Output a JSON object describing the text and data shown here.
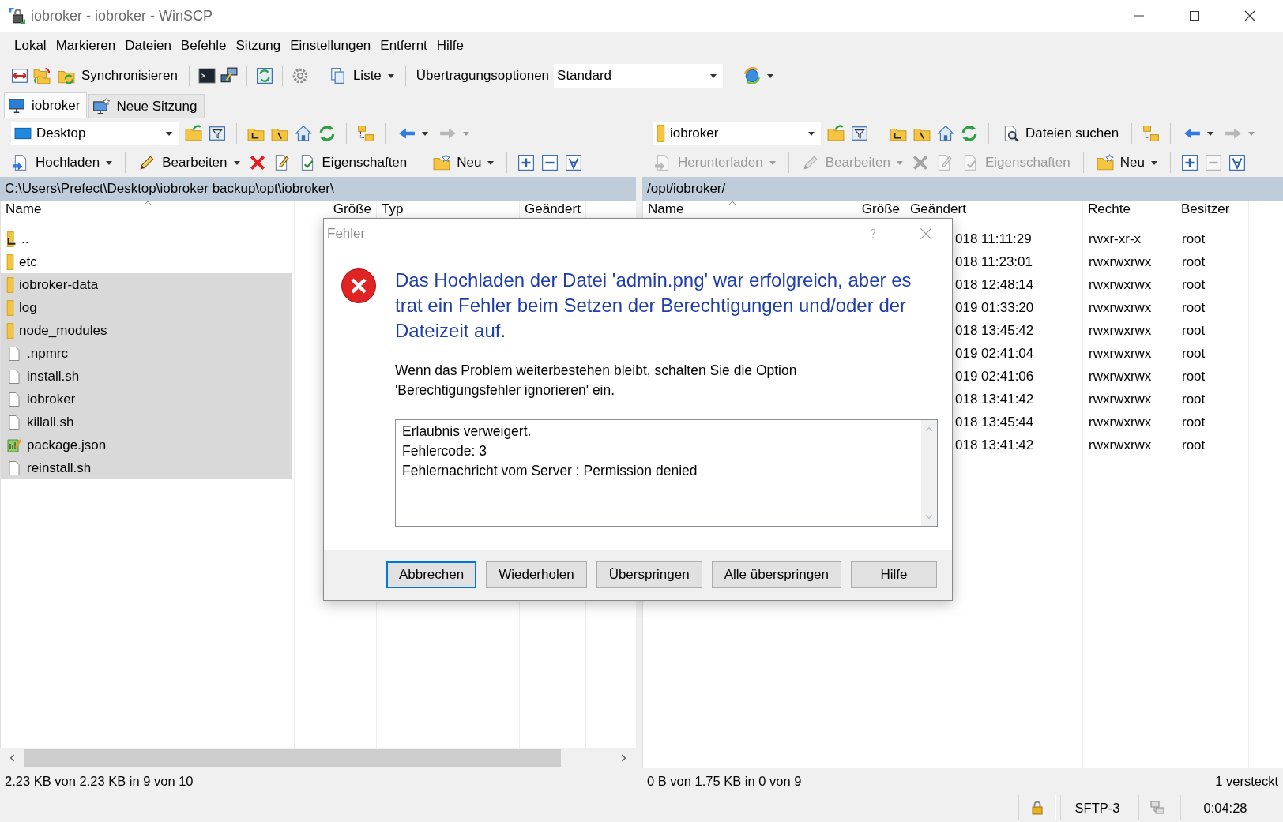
{
  "window": {
    "title": "iobroker - iobroker - WinSCP"
  },
  "menu": [
    "Lokal",
    "Markieren",
    "Dateien",
    "Befehle",
    "Sitzung",
    "Einstellungen",
    "Entfernt",
    "Hilfe"
  ],
  "toolbar": {
    "sync_label": "Synchronisieren",
    "view_label": "Liste",
    "transfer_label": "Übertragungsoptionen",
    "transfer_value": "Standard"
  },
  "session_tabs": [
    {
      "label": "iobroker",
      "selected": true
    },
    {
      "label": "Neue Sitzung",
      "selected": false
    }
  ],
  "left_panel": {
    "location": "Desktop",
    "history": {
      "back_disabled": false,
      "forward_disabled": true
    },
    "actions": [
      {
        "kind": "upload",
        "label": "Hochladen",
        "disabled": false
      },
      {
        "kind": "edit",
        "label": "Bearbeiten",
        "disabled": false
      },
      {
        "kind": "delete",
        "disabled": false
      },
      {
        "kind": "rename",
        "disabled": false
      },
      {
        "kind": "properties",
        "label": "Eigenschaften",
        "disabled": false
      },
      {
        "kind": "new",
        "label": "Neu",
        "disabled": false
      },
      {
        "kind": "select",
        "disabled": false
      },
      {
        "kind": "unselect",
        "disabled": false
      },
      {
        "kind": "filter_select",
        "disabled": false
      }
    ],
    "path": "C:\\Users\\Prefect\\Desktop\\iobroker backup\\opt\\iobroker\\",
    "columns": [
      "Name",
      "Größe",
      "Typ",
      "Geändert"
    ],
    "rows": [
      {
        "kind": "parent",
        "name": "..",
        "selected": false
      },
      {
        "kind": "folder",
        "name": "etc",
        "selected": false
      },
      {
        "kind": "folder",
        "name": "iobroker-data",
        "selected": true
      },
      {
        "kind": "folder",
        "name": "log",
        "selected": true
      },
      {
        "kind": "folder",
        "name": "node_modules",
        "selected": true
      },
      {
        "kind": "file",
        "name": ".npmrc",
        "selected": true
      },
      {
        "kind": "file",
        "name": "install.sh",
        "selected": true
      },
      {
        "kind": "file",
        "name": "iobroker",
        "selected": true
      },
      {
        "kind": "file",
        "name": "killall.sh",
        "selected": true
      },
      {
        "kind": "json",
        "name": "package.json",
        "selected": true
      },
      {
        "kind": "file",
        "name": "reinstall.sh",
        "selected": true
      }
    ],
    "status": "2.23 KB von 2.23 KB in 9 von 10"
  },
  "right_panel": {
    "location": "iobroker",
    "search_label": "Dateien suchen",
    "history": {
      "back_disabled": false,
      "forward_disabled": true
    },
    "actions": [
      {
        "kind": "download",
        "label": "Herunterladen",
        "disabled": true
      },
      {
        "kind": "edit",
        "label": "Bearbeiten",
        "disabled": true
      },
      {
        "kind": "delete",
        "disabled": true
      },
      {
        "kind": "rename",
        "disabled": true
      },
      {
        "kind": "properties",
        "label": "Eigenschaften",
        "disabled": true
      },
      {
        "kind": "new",
        "label": "Neu",
        "disabled": false
      },
      {
        "kind": "select",
        "disabled": false
      },
      {
        "kind": "unselect",
        "disabled": true
      },
      {
        "kind": "filter_select",
        "disabled": false
      }
    ],
    "path": "/opt/iobroker/",
    "columns": [
      "Name",
      "Größe",
      "Geändert",
      "Rechte",
      "Besitzer"
    ],
    "rows": [
      {
        "modified": "018 11:11:29",
        "rights": "rwxr-xr-x",
        "owner": "root"
      },
      {
        "modified": "018 11:23:01",
        "rights": "rwxrwxrwx",
        "owner": "root"
      },
      {
        "modified": "018 12:48:14",
        "rights": "rwxrwxrwx",
        "owner": "root"
      },
      {
        "modified": "019 01:33:20",
        "rights": "rwxrwxrwx",
        "owner": "root"
      },
      {
        "modified": "018 13:45:42",
        "rights": "rwxrwxrwx",
        "owner": "root"
      },
      {
        "modified": "019 02:41:04",
        "rights": "rwxrwxrwx",
        "owner": "root"
      },
      {
        "modified": "019 02:41:06",
        "rights": "rwxrwxrwx",
        "owner": "root"
      },
      {
        "modified": "018 13:41:42",
        "rights": "rwxrwxrwx",
        "owner": "root"
      },
      {
        "modified": "018 13:45:44",
        "rights": "rwxrwxrwx",
        "owner": "root"
      },
      {
        "modified": "018 13:41:42",
        "rights": "rwxrwxrwx",
        "owner": "root"
      }
    ],
    "status": "0 B von 1.75 KB in 0 von 9",
    "hidden_count": "1 versteckt"
  },
  "status_bar": {
    "protocol": "SFTP-3",
    "elapsed": "0:04:28"
  },
  "dialog": {
    "title": "Fehler",
    "heading": "Das Hochladen der Datei 'admin.png' war erfolgreich, aber es trat ein Fehler beim Setzen der Berechtigungen und/oder der Dateizeit auf.",
    "message": "Wenn das Problem weiterbestehen bleibt, schalten Sie die Option 'Berechtigungsfehler ignorieren' ein.",
    "details": [
      "Erlaubnis verweigert.",
      "Fehlercode: 3",
      "Fehlernachricht vom Server : Permission denied"
    ],
    "buttons": [
      {
        "label": "Abbrechen",
        "default": true
      },
      {
        "label": "Wiederholen",
        "default": false
      },
      {
        "label": "Überspringen",
        "default": false
      },
      {
        "label": "Alle überspringen",
        "default": false
      },
      {
        "label": "Hilfe",
        "default": false
      }
    ]
  }
}
